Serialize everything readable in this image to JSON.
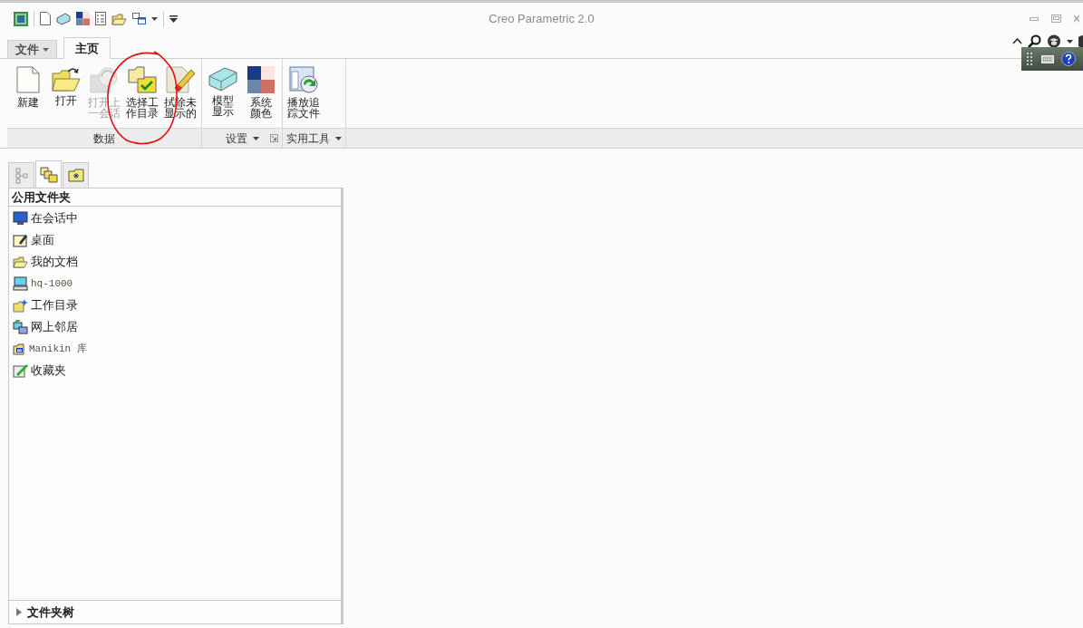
{
  "window": {
    "title": "Creo Parametric 2.0"
  },
  "ribbon_tabs": [
    {
      "label": "文件",
      "dropdown": true,
      "selected": false
    },
    {
      "label": "主页",
      "dropdown": false,
      "selected": true
    }
  ],
  "ribbon_groups": [
    {
      "label": "数据",
      "dropdown": false,
      "launcher": false,
      "buttons": [
        {
          "lines": [
            "新建"
          ],
          "disabled": false
        },
        {
          "lines": [
            "打开"
          ],
          "disabled": false
        },
        {
          "lines": [
            "打开上",
            "一会话"
          ],
          "disabled": true
        },
        {
          "lines": [
            "选择工",
            "作目录"
          ],
          "disabled": false
        },
        {
          "lines": [
            "拭除未",
            "显示的"
          ],
          "disabled": false
        }
      ]
    },
    {
      "label": "设置",
      "dropdown": true,
      "launcher": true,
      "buttons": [
        {
          "lines": [
            "模型",
            "显示"
          ],
          "disabled": false
        },
        {
          "lines": [
            "系统",
            "颜色"
          ],
          "disabled": false
        }
      ]
    },
    {
      "label": "实用工具",
      "dropdown": true,
      "launcher": false,
      "buttons": [
        {
          "lines": [
            "播放追",
            "踪文件"
          ],
          "disabled": false
        }
      ]
    }
  ],
  "navigator": {
    "tabs": [
      {
        "selected": false
      },
      {
        "selected": true
      },
      {
        "selected": false
      }
    ],
    "header": "公用文件夹",
    "items": [
      {
        "label": "在会话中",
        "kind": "label"
      },
      {
        "label": "桌面",
        "kind": "label"
      },
      {
        "label": "我的文档",
        "kind": "label"
      },
      {
        "label": "hq-1000",
        "kind": "path"
      },
      {
        "label": "工作目录",
        "kind": "label"
      },
      {
        "label": "网上邻居",
        "kind": "label"
      },
      {
        "label": "Manikin 库",
        "kind": "path"
      },
      {
        "label": "收藏夹",
        "kind": "label"
      }
    ],
    "folder_tree": {
      "label": "文件夹树",
      "expanded": false
    }
  }
}
